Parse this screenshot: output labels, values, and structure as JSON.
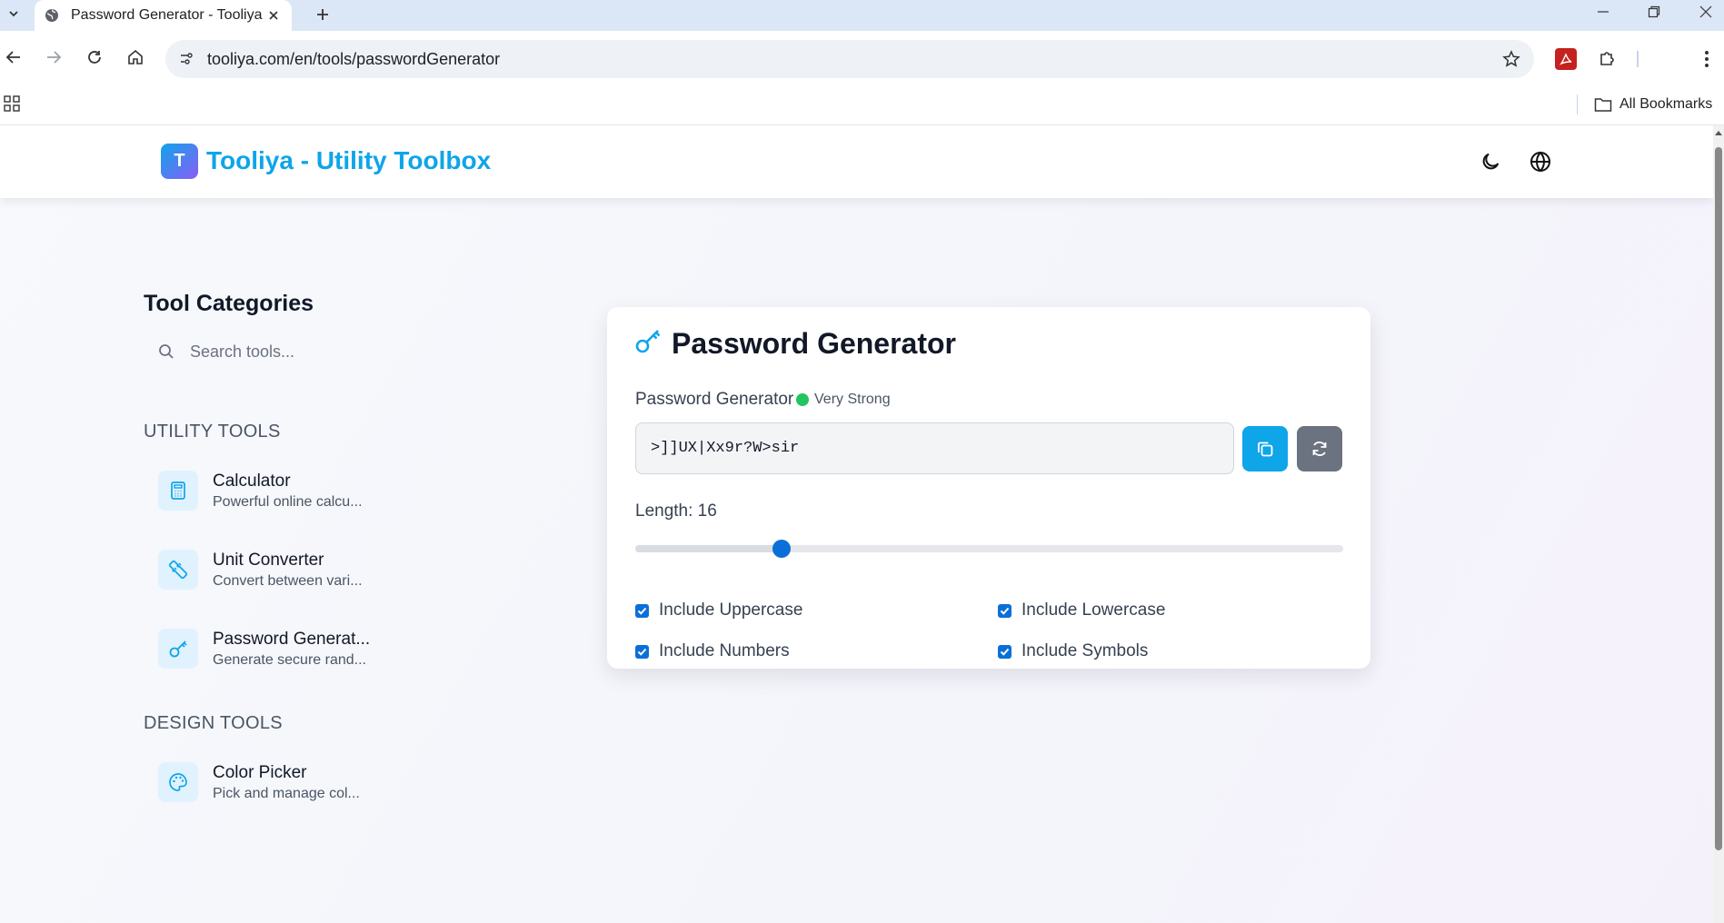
{
  "browser": {
    "tab_title": "Password Generator - Tooliya",
    "url": "tooliya.com/en/tools/passwordGenerator",
    "bookmarks_label": "All Bookmarks"
  },
  "site": {
    "logo_letter": "T",
    "title": "Tooliya - Utility Toolbox"
  },
  "sidebar": {
    "title": "Tool Categories",
    "search_placeholder": "Search tools...",
    "sections": [
      {
        "label": "UTILITY TOOLS",
        "items": [
          {
            "name": "Calculator",
            "desc": "Powerful online calcu...",
            "icon": "calculator-icon"
          },
          {
            "name": "Unit Converter",
            "desc": "Convert between vari...",
            "icon": "ruler-icon"
          },
          {
            "name": "Password Generat...",
            "desc": "Generate secure rand...",
            "icon": "key-icon"
          }
        ]
      },
      {
        "label": "DESIGN TOOLS",
        "items": [
          {
            "name": "Color Picker",
            "desc": "Pick and manage col...",
            "icon": "palette-icon"
          }
        ]
      }
    ]
  },
  "tool": {
    "title": "Password Generator",
    "field_label": "Password Generator",
    "strength": "Very Strong",
    "strength_color": "#22c55e",
    "password": ">]]UX|Xx9r?W>sir",
    "length_label": "Length: 16",
    "length_fraction": 0.207,
    "options": {
      "uppercase": "Include Uppercase",
      "lowercase": "Include Lowercase",
      "numbers": "Include Numbers",
      "symbols": "Include Symbols"
    }
  },
  "colors": {
    "accent": "#0ea5e9",
    "slider": "#0b6fd8",
    "secondary_button": "#6b7280"
  }
}
